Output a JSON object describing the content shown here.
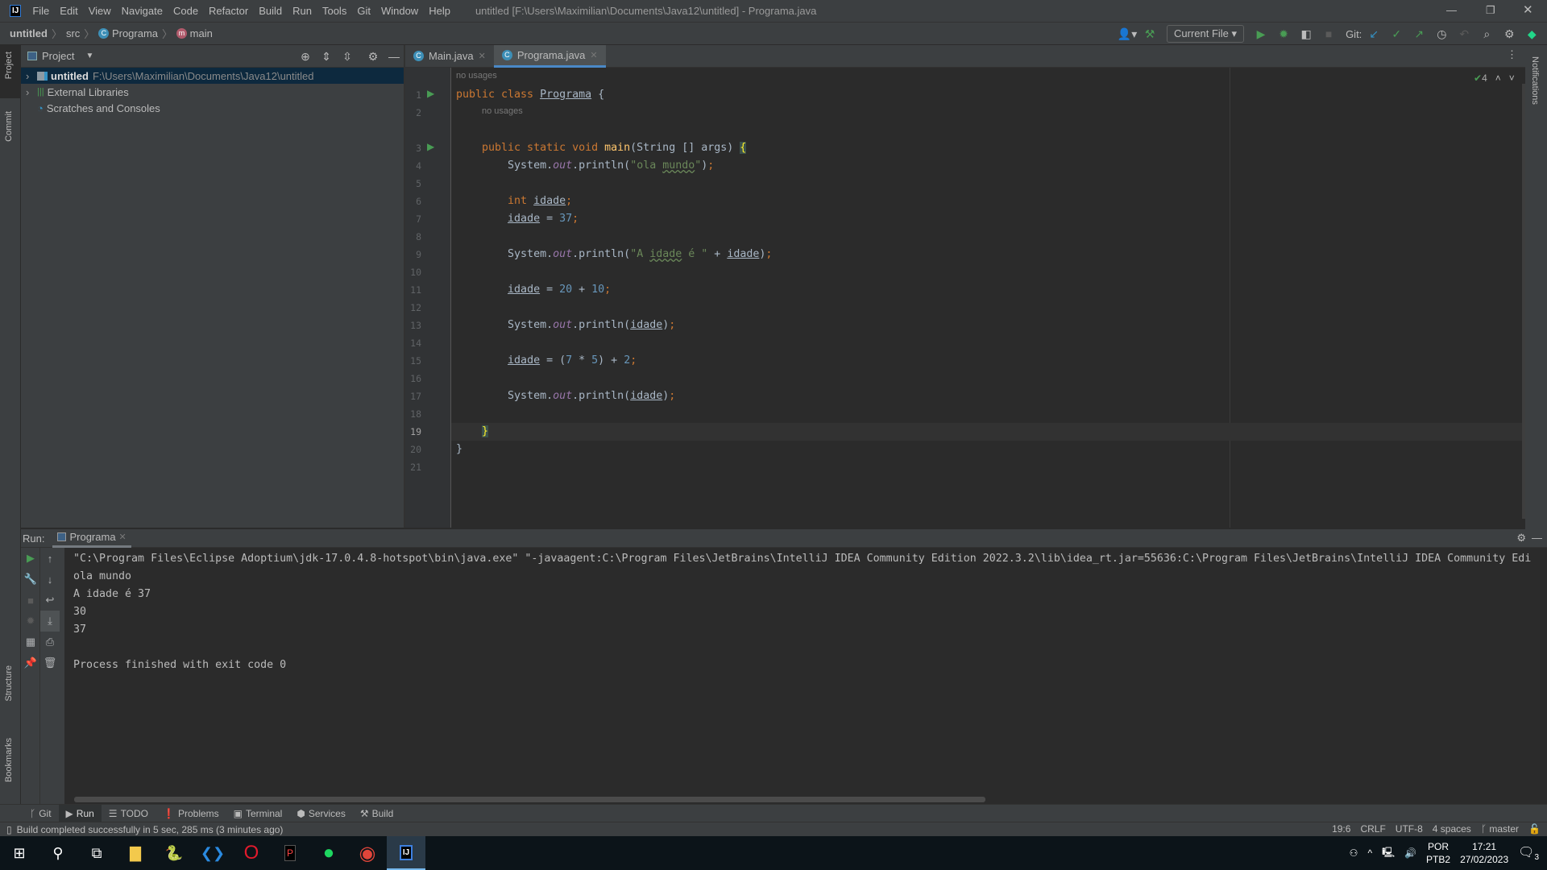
{
  "window": {
    "title": "untitled [F:\\Users\\Maximilian\\Documents\\Java12\\untitled] - Programa.java",
    "logo": "IJ"
  },
  "menu": [
    "File",
    "Edit",
    "View",
    "Navigate",
    "Code",
    "Refactor",
    "Build",
    "Run",
    "Tools",
    "Git",
    "Window",
    "Help"
  ],
  "breadcrumb": [
    "untitled",
    "src",
    "Programa",
    "main"
  ],
  "toolbar": {
    "run_config": "Current File",
    "git_label": "Git:"
  },
  "project": {
    "title": "Project",
    "tree": [
      {
        "label": "untitled",
        "path": "F:\\Users\\Maximilian\\Documents\\Java12\\untitled",
        "selected": true
      },
      {
        "label": "External Libraries"
      },
      {
        "label": "Scratches and Consoles"
      }
    ]
  },
  "left_stripe": [
    "Project",
    "Commit",
    "Structure",
    "Bookmarks"
  ],
  "right_stripe": [
    "Notifications"
  ],
  "tabs": [
    {
      "label": "Main.java",
      "active": false
    },
    {
      "label": "Programa.java",
      "active": true
    }
  ],
  "editor": {
    "inspections_count": "4",
    "inlay": "no usages",
    "current_line": 19,
    "lines": [
      [
        [
          "kw",
          "public class "
        ],
        [
          "var",
          "Programa"
        ],
        [
          "plain",
          " {"
        ]
      ],
      [],
      [
        [
          "kw",
          "    public static void "
        ],
        [
          "fn",
          "main"
        ],
        [
          "plain",
          "(String [] args) "
        ],
        [
          "brace",
          "{"
        ]
      ],
      [
        [
          "plain",
          "        System."
        ],
        [
          "field",
          "out"
        ],
        [
          "plain",
          ".println("
        ],
        [
          "str",
          "\"ola "
        ],
        [
          "typo",
          "mundo"
        ],
        [
          "str",
          "\""
        ],
        [
          "plain",
          ")"
        ],
        [
          "kw",
          ";"
        ]
      ],
      [],
      [
        [
          "kw",
          "        int "
        ],
        [
          "var",
          "idade"
        ],
        [
          "kw",
          ";"
        ]
      ],
      [
        [
          "plain",
          "        "
        ],
        [
          "var",
          "idade"
        ],
        [
          "plain",
          " = "
        ],
        [
          "num",
          "37"
        ],
        [
          "kw",
          ";"
        ]
      ],
      [],
      [
        [
          "plain",
          "        System."
        ],
        [
          "field",
          "out"
        ],
        [
          "plain",
          ".println("
        ],
        [
          "str",
          "\"A "
        ],
        [
          "typo",
          "idade"
        ],
        [
          "str",
          " é \""
        ],
        [
          "plain",
          " + "
        ],
        [
          "var",
          "idade"
        ],
        [
          "plain",
          ")"
        ],
        [
          "kw",
          ";"
        ]
      ],
      [],
      [
        [
          "plain",
          "        "
        ],
        [
          "var",
          "idade"
        ],
        [
          "plain",
          " = "
        ],
        [
          "num",
          "20"
        ],
        [
          "plain",
          " + "
        ],
        [
          "num",
          "10"
        ],
        [
          "kw",
          ";"
        ]
      ],
      [],
      [
        [
          "plain",
          "        System."
        ],
        [
          "field",
          "out"
        ],
        [
          "plain",
          ".println("
        ],
        [
          "var",
          "idade"
        ],
        [
          "plain",
          ")"
        ],
        [
          "kw",
          ";"
        ]
      ],
      [],
      [
        [
          "plain",
          "        "
        ],
        [
          "var",
          "idade"
        ],
        [
          "plain",
          " = ("
        ],
        [
          "num",
          "7"
        ],
        [
          "plain",
          " * "
        ],
        [
          "num",
          "5"
        ],
        [
          "plain",
          ") + "
        ],
        [
          "num",
          "2"
        ],
        [
          "kw",
          ";"
        ]
      ],
      [],
      [
        [
          "plain",
          "        System."
        ],
        [
          "field",
          "out"
        ],
        [
          "plain",
          ".println("
        ],
        [
          "var",
          "idade"
        ],
        [
          "plain",
          ")"
        ],
        [
          "kw",
          ";"
        ]
      ],
      [],
      [
        [
          "plain",
          "    "
        ],
        [
          "brace",
          "}"
        ]
      ],
      [
        [
          "plain",
          "}"
        ]
      ],
      []
    ]
  },
  "run": {
    "label": "Run:",
    "tab": "Programa",
    "console": [
      "\"C:\\Program Files\\Eclipse Adoptium\\jdk-17.0.4.8-hotspot\\bin\\java.exe\" \"-javaagent:C:\\Program Files\\JetBrains\\IntelliJ IDEA Community Edition 2022.3.2\\lib\\idea_rt.jar=55636:C:\\Program Files\\JetBrains\\IntelliJ IDEA Community Edi",
      "ola mundo",
      "A idade é 37",
      "30",
      "37",
      "",
      "Process finished with exit code 0"
    ]
  },
  "bottom_tools": [
    "Git",
    "Run",
    "TODO",
    "Problems",
    "Terminal",
    "Services",
    "Build"
  ],
  "status": {
    "message": "Build completed successfully in 5 sec, 285 ms (3 minutes ago)",
    "position": "19:6",
    "line_sep": "CRLF",
    "encoding": "UTF-8",
    "indent": "4 spaces",
    "branch": "master"
  },
  "taskbar": {
    "lang": "POR",
    "layout": "PTB2",
    "time": "17:21",
    "date": "27/02/2023",
    "notifications": "3"
  },
  "colors": {
    "accent": "#4a88c7",
    "keyword": "#cc7832",
    "string": "#6a8759",
    "number": "#6897bb",
    "run_green": "#499c54"
  }
}
